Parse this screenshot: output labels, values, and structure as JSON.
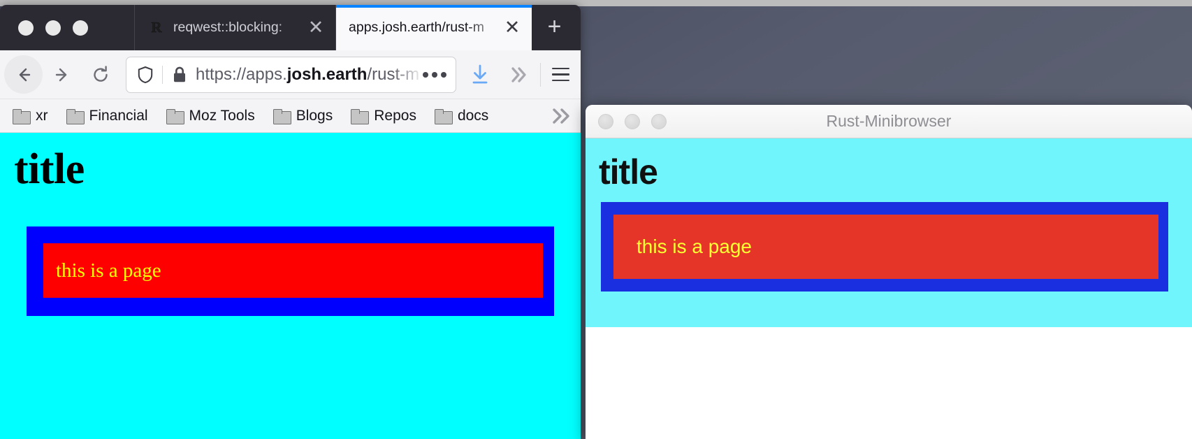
{
  "desktop": {
    "background_color": "#51576a",
    "menubar_color": "#bcbcbc"
  },
  "firefox": {
    "traffic_lights": [
      "close",
      "minimize",
      "zoom"
    ],
    "tabs": [
      {
        "title": "reqwest::blocking:",
        "favicon": "R",
        "active": false,
        "close_label": "✕"
      },
      {
        "title": "apps.josh.earth/rust-m",
        "favicon": "",
        "active": true,
        "close_label": "✕"
      }
    ],
    "new_tab_label": "+",
    "toolbar": {
      "back_label": "back-arrow",
      "forward_label": "forward-arrow",
      "reload_label": "reload",
      "download_label": "download",
      "overflow_label": "»",
      "menu_label": "hamburger-menu"
    },
    "urlbar": {
      "scheme": "https://apps.",
      "domain": "josh.earth",
      "rest": "/rust-m",
      "full_url": "https://apps.josh.earth/rust-m",
      "shield_icon": "tracking-protection-shield",
      "lock_icon": "padlock-secure",
      "page_actions_label": "•••"
    },
    "bookmarks": [
      {
        "label": "xr"
      },
      {
        "label": "Financial"
      },
      {
        "label": "Moz Tools"
      },
      {
        "label": "Blogs"
      },
      {
        "label": "Repos"
      },
      {
        "label": "docs"
      }
    ],
    "bookmarks_overflow_label": "»",
    "page": {
      "background_color": "#00ffff",
      "title": "title",
      "title_color": "#000000",
      "outer_box_color": "#0000ff",
      "inner_box_color": "#ff0000",
      "body_text": "this is a page",
      "body_text_color": "#ffff00"
    }
  },
  "rust_minibrowser": {
    "window_title": "Rust-Minibrowser",
    "traffic_lights": [
      "close",
      "minimize",
      "zoom"
    ],
    "page": {
      "background_color": "#6ff5fb",
      "title": "title",
      "title_color": "#101010",
      "outer_box_color": "#1a2fe0",
      "inner_box_color": "#e53428",
      "body_text": "this is a page",
      "body_text_color": "#ffff33",
      "viewport_background": "#ffffff"
    }
  }
}
